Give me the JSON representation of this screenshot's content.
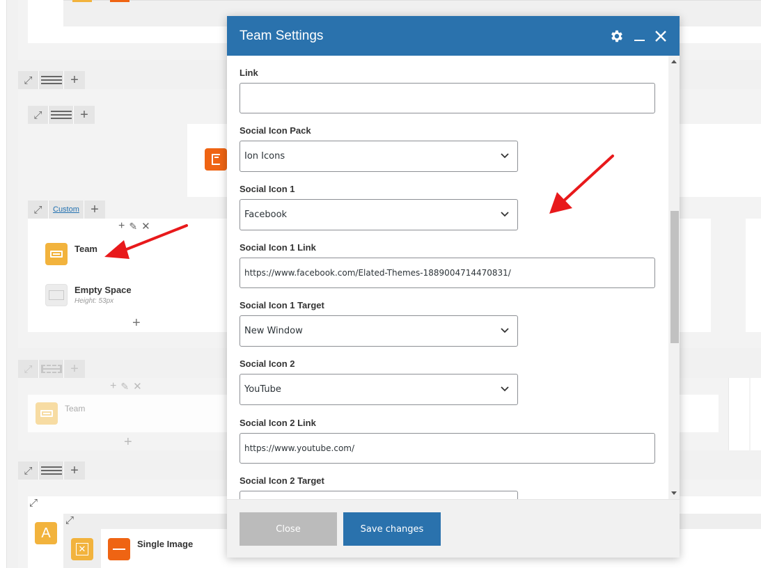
{
  "modal": {
    "title": "Team Settings",
    "fields": [
      {
        "label": "Link",
        "type": "text",
        "value": ""
      },
      {
        "label": "Social Icon Pack",
        "type": "select",
        "value": "Ion Icons"
      },
      {
        "label": "Social Icon 1",
        "type": "select",
        "value": "Facebook"
      },
      {
        "label": "Social Icon 1 Link",
        "type": "text",
        "value": "https://www.facebook.com/Elated-Themes-1889004714470831/"
      },
      {
        "label": "Social Icon 1 Target",
        "type": "select",
        "value": "New Window"
      },
      {
        "label": "Social Icon 2",
        "type": "select",
        "value": "YouTube"
      },
      {
        "label": "Social Icon 2 Link",
        "type": "text",
        "value": "https://www.youtube.com/"
      },
      {
        "label": "Social Icon 2 Target",
        "type": "select",
        "value": ""
      }
    ],
    "close_label": "Close",
    "save_label": "Save changes"
  },
  "builder": {
    "custom_link": "Custom",
    "team_element": {
      "title": "Team"
    },
    "empty_space": {
      "title": "Empty Space",
      "sub": "Height: 53px"
    },
    "team_element_faded": {
      "title": "Team"
    },
    "single_image": {
      "title": "Single Image"
    },
    "text_block_letter": "A"
  },
  "colors": {
    "modal_header": "#2a72ad",
    "arrow": "#e8191b",
    "element_orange": "#f2b33d",
    "element_deep_orange": "#ef6413"
  }
}
